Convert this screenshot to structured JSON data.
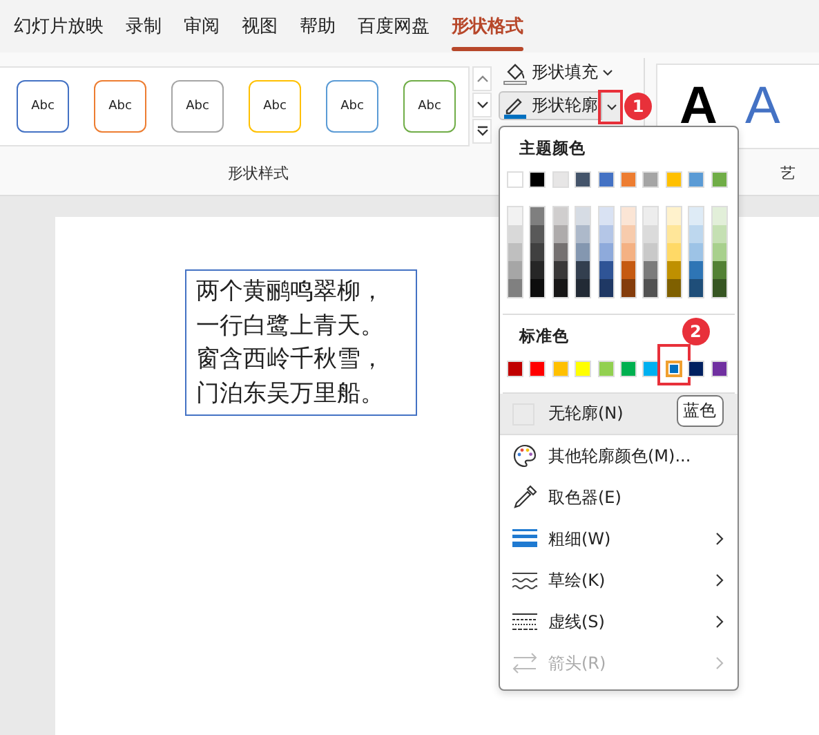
{
  "tabs": [
    {
      "label": "幻灯片放映",
      "selected": false
    },
    {
      "label": "录制",
      "selected": false
    },
    {
      "label": "审阅",
      "selected": false
    },
    {
      "label": "视图",
      "selected": false
    },
    {
      "label": "帮助",
      "selected": false
    },
    {
      "label": "百度网盘",
      "selected": false
    },
    {
      "label": "形状格式",
      "selected": true
    }
  ],
  "shape_styles": {
    "items": [
      {
        "label": "Abc",
        "color": "#4472c4"
      },
      {
        "label": "Abc",
        "color": "#ed7d31"
      },
      {
        "label": "Abc",
        "color": "#a5a5a5"
      },
      {
        "label": "Abc",
        "color": "#ffc000"
      },
      {
        "label": "Abc",
        "color": "#5b9bd5"
      },
      {
        "label": "Abc",
        "color": "#70ad47"
      }
    ],
    "group_label": "形状样式"
  },
  "fill_button": {
    "label": "形状填充"
  },
  "outline_button": {
    "label": "形状轮廓",
    "pressed": true,
    "annotation": "1"
  },
  "wordart": {
    "samples": [
      {
        "text": "A",
        "kind": "black"
      },
      {
        "text": "A",
        "kind": "blue"
      }
    ],
    "group_label": "艺"
  },
  "slide": {
    "text_lines": [
      "两个黄鹂鸣翠柳，",
      "一行白鹭上青天。",
      "窗含西岭千秋雪，",
      "门泊东吴万里船。"
    ]
  },
  "menu": {
    "theme_header": "主题颜色",
    "theme_colors": [
      {
        "color": "#ffffff",
        "selected": false,
        "shades": [
          {
            "color": "#f2f2f2",
            "selected": false
          },
          {
            "color": "#d9d9d9",
            "selected": false
          },
          {
            "color": "#bfbfbf",
            "selected": false
          },
          {
            "color": "#a6a6a6",
            "selected": false
          },
          {
            "color": "#808080",
            "selected": false
          }
        ]
      },
      {
        "color": "#000000",
        "selected": false,
        "shades": [
          {
            "color": "#7f7f7f",
            "selected": false
          },
          {
            "color": "#595959",
            "selected": false
          },
          {
            "color": "#404040",
            "selected": false
          },
          {
            "color": "#262626",
            "selected": false
          },
          {
            "color": "#0d0d0d",
            "selected": false
          }
        ]
      },
      {
        "color": "#e7e6e6",
        "selected": false,
        "shades": [
          {
            "color": "#d0cece",
            "selected": false
          },
          {
            "color": "#aeabab",
            "selected": false
          },
          {
            "color": "#757171",
            "selected": false
          },
          {
            "color": "#3a3838",
            "selected": false
          },
          {
            "color": "#171616",
            "selected": false
          }
        ]
      },
      {
        "color": "#44546a",
        "selected": false,
        "shades": [
          {
            "color": "#d6dce4",
            "selected": false
          },
          {
            "color": "#adb9ca",
            "selected": false
          },
          {
            "color": "#8497b0",
            "selected": false
          },
          {
            "color": "#333f4f",
            "selected": false
          },
          {
            "color": "#222a35",
            "selected": false
          }
        ]
      },
      {
        "color": "#4472c4",
        "selected": false,
        "shades": [
          {
            "color": "#d9e2f3",
            "selected": false
          },
          {
            "color": "#b4c6e7",
            "selected": false
          },
          {
            "color": "#8eaadb",
            "selected": false
          },
          {
            "color": "#2f5496",
            "selected": false
          },
          {
            "color": "#1f3864",
            "selected": false
          }
        ]
      },
      {
        "color": "#ed7d31",
        "selected": false,
        "shades": [
          {
            "color": "#fbe5d5",
            "selected": false
          },
          {
            "color": "#f7cbac",
            "selected": false
          },
          {
            "color": "#f4b183",
            "selected": false
          },
          {
            "color": "#c55a11",
            "selected": false
          },
          {
            "color": "#843c0b",
            "selected": false
          }
        ]
      },
      {
        "color": "#a5a5a5",
        "selected": false,
        "shades": [
          {
            "color": "#ededed",
            "selected": false
          },
          {
            "color": "#dbdbdb",
            "selected": false
          },
          {
            "color": "#c9c9c9",
            "selected": false
          },
          {
            "color": "#7b7b7b",
            "selected": false
          },
          {
            "color": "#525252",
            "selected": false
          }
        ]
      },
      {
        "color": "#ffc000",
        "selected": false,
        "shades": [
          {
            "color": "#fff2cc",
            "selected": false
          },
          {
            "color": "#ffe699",
            "selected": false
          },
          {
            "color": "#ffd966",
            "selected": false
          },
          {
            "color": "#bf9000",
            "selected": false
          },
          {
            "color": "#7f6000",
            "selected": false
          }
        ]
      },
      {
        "color": "#5b9bd5",
        "selected": false,
        "shades": [
          {
            "color": "#deebf6",
            "selected": false
          },
          {
            "color": "#bdd7ee",
            "selected": false
          },
          {
            "color": "#9dc3e6",
            "selected": false
          },
          {
            "color": "#2e75b5",
            "selected": false
          },
          {
            "color": "#1f4e79",
            "selected": false
          }
        ]
      },
      {
        "color": "#70ad47",
        "selected": false,
        "shades": [
          {
            "color": "#e2efd9",
            "selected": false
          },
          {
            "color": "#c5e0b3",
            "selected": false
          },
          {
            "color": "#a8d08d",
            "selected": false
          },
          {
            "color": "#538135",
            "selected": false
          },
          {
            "color": "#375623",
            "selected": false
          }
        ]
      }
    ],
    "standard_header": "标准色",
    "standard_colors": [
      {
        "color": "#c00000",
        "selected": false
      },
      {
        "color": "#ff0000",
        "selected": false
      },
      {
        "color": "#ffc000",
        "selected": false
      },
      {
        "color": "#ffff00",
        "selected": false
      },
      {
        "color": "#92d050",
        "selected": false
      },
      {
        "color": "#00b050",
        "selected": false
      },
      {
        "color": "#00b0f0",
        "selected": false
      },
      {
        "color": "#0070c0",
        "selected": true,
        "annotation": "2",
        "tooltip": "蓝色"
      },
      {
        "color": "#002060",
        "selected": false
      },
      {
        "color": "#7030a0",
        "selected": false
      }
    ],
    "items": [
      {
        "kind": "none",
        "label": "无轮廓(N)",
        "highlighted": true,
        "submenu": false,
        "disabled": false
      },
      {
        "kind": "palette",
        "label": "其他轮廓颜色(M)...",
        "highlighted": false,
        "submenu": false,
        "disabled": false
      },
      {
        "kind": "eyedropper",
        "label": "取色器(E)",
        "highlighted": false,
        "submenu": false,
        "disabled": false
      },
      {
        "kind": "weight",
        "label": "粗细(W)",
        "highlighted": false,
        "submenu": true,
        "disabled": false
      },
      {
        "kind": "sketch",
        "label": "草绘(K)",
        "highlighted": false,
        "submenu": true,
        "disabled": false
      },
      {
        "kind": "dash",
        "label": "虚线(S)",
        "highlighted": false,
        "submenu": true,
        "disabled": false
      },
      {
        "kind": "arrow",
        "label": "箭头(R)",
        "highlighted": false,
        "submenu": true,
        "disabled": true
      }
    ]
  }
}
